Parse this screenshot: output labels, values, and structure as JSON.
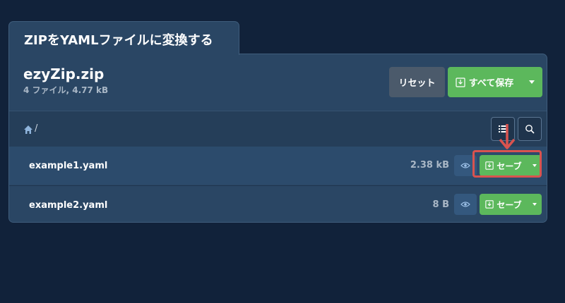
{
  "tab": {
    "title": "ZIPをYAMLファイルに変換する"
  },
  "archive": {
    "name": "ezyZip.zip",
    "meta": "4 ファイル, 4.77 kB"
  },
  "buttons": {
    "reset": "リセット",
    "save_all": "すべて保存",
    "save": "セーブ"
  },
  "breadcrumb": {
    "separator": "/"
  },
  "files": [
    {
      "name": "example1.yaml",
      "size": "2.38 kB"
    },
    {
      "name": "example2.yaml",
      "size": "8 B"
    }
  ],
  "colors": {
    "background": "#11223a",
    "panel": "#2a4664",
    "accent_green": "#5cb85c",
    "highlight_red": "#d9534f"
  },
  "icons": [
    "home-icon",
    "list-icon",
    "search-icon",
    "download-icon",
    "eye-icon",
    "caret-down-icon",
    "arrow-down-icon"
  ]
}
